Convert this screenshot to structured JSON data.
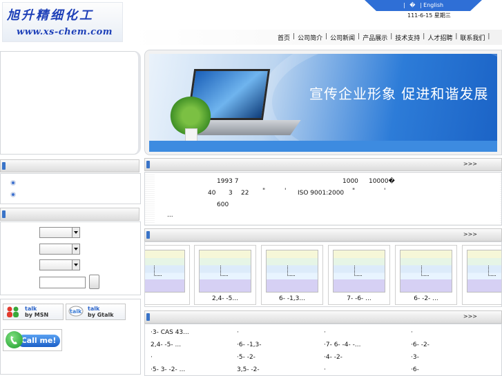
{
  "header": {
    "logo_cn": "旭升精细化工",
    "logo_url": "www.xs-chem.com",
    "lang": [
      "|",
      "�",
      "| English"
    ],
    "date": "111-6-15 星期三"
  },
  "nav": [
    "首页",
    "公司简介",
    "公司新闻",
    "产品展示",
    "技术支持",
    "人才招聘",
    "联系我们"
  ],
  "banner": {
    "slogan": "宣传企业形象  促进和谐发展"
  },
  "sections": {
    "about_more": ">>>",
    "products_more": ">>>",
    "list_more": ">>>"
  },
  "about": {
    "line1_year": "1993 7",
    "line1_a": "1000",
    "line1_b": "10000�",
    "line2_a": "40",
    "line2_b": "3",
    "line2_c": "22",
    "line2_q1": "\"",
    "line2_dot1": "'",
    "line2_iso": "ISO 9001:2000",
    "line2_q2": "\"",
    "line2_dot2": "'",
    "line3": "600",
    "line4": "..."
  },
  "products": [
    {
      "caption": ""
    },
    {
      "caption": "2,4- -5..."
    },
    {
      "caption": "6- -1,3..."
    },
    {
      "caption": "7- -6- ..."
    },
    {
      "caption": "6- -2- ..."
    },
    {
      "caption": ""
    }
  ],
  "product_list": [
    [
      "·3-    CAS 43...",
      "·",
      "·",
      "·"
    ],
    [
      "2,4- -5-   ...",
      "·6- -1,3-",
      "·7- 6- -4-  -...",
      "·6- -2-"
    ],
    [
      "·",
      "·5- -2-",
      "·4- -2-",
      "·3-"
    ],
    [
      "·5- 3- -2-   ...",
      "3,5- -2-",
      "·",
      "·6-"
    ]
  ],
  "contact": {
    "msn_top": "talk",
    "msn_bottom": "by MSN",
    "gtalk_top": "talk",
    "gtalk_bottom": "by Gtalk",
    "callme": "Call me!"
  }
}
